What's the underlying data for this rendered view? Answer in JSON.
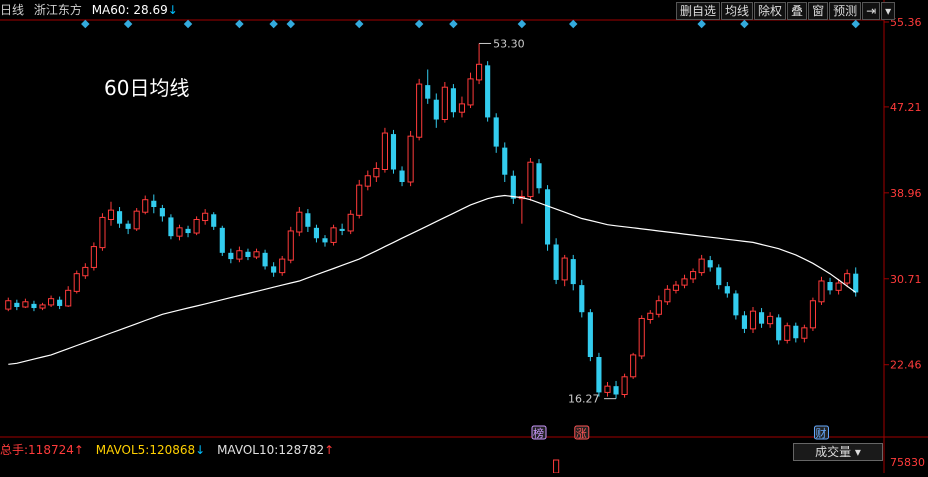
{
  "header": {
    "period": "日线",
    "stock_name": "浙江东方",
    "ma_label": "MA60:",
    "ma_value": "28.69",
    "ma_arrow": "↓"
  },
  "toolbar": {
    "buttons": [
      "删自选",
      "均线",
      "除权",
      "叠",
      "窗",
      "预测"
    ],
    "nav_icon": "nav-arrow-icon",
    "dropdown_icon": "triangle-down-icon"
  },
  "annotation": "60日均线",
  "volume_bar": {
    "total_label": "总手:",
    "total_value": "118724",
    "total_arrow": "↑",
    "mavol5_label": "MAVOL5:",
    "mavol5_value": "120868",
    "mavol5_arrow": "↓",
    "mavol10_label": "MAVOL10:",
    "mavol10_value": "128782",
    "mavol10_arrow": "↑",
    "indicator_button": "成交量"
  },
  "markers": {
    "bang": "榜",
    "zhang": "涨",
    "cai": "财"
  },
  "colors": {
    "background": "#000000",
    "up": "#ff3b3b",
    "down": "#33ccee",
    "ma_line": "#ffffff",
    "axis": "#a00000",
    "info_diamond": "#33aadd"
  },
  "chart_data": {
    "type": "candlestick",
    "y_axis_ticks": [
      "55.36",
      "47.21",
      "38.96",
      "30.71",
      "22.46"
    ],
    "ylim": [
      16.0,
      55.36
    ],
    "volume_axis_label": "75830",
    "high_label": "53.30",
    "low_label": "16.27",
    "series": [
      {
        "name": "MA60",
        "values": [
          22.5,
          22.6,
          22.8,
          23.0,
          23.2,
          23.4,
          23.7,
          24.0,
          24.3,
          24.6,
          24.9,
          25.2,
          25.5,
          25.8,
          26.1,
          26.4,
          26.7,
          27.0,
          27.3,
          27.5,
          27.7,
          27.9,
          28.1,
          28.3,
          28.5,
          28.7,
          28.9,
          29.1,
          29.3,
          29.5,
          29.7,
          29.9,
          30.1,
          30.3,
          30.5,
          30.8,
          31.1,
          31.4,
          31.7,
          32.0,
          32.3,
          32.6,
          33.0,
          33.4,
          33.8,
          34.2,
          34.6,
          35.0,
          35.4,
          35.8,
          36.2,
          36.6,
          37.0,
          37.4,
          37.8,
          38.1,
          38.4,
          38.6,
          38.7,
          38.6,
          38.5,
          38.3,
          38.0,
          37.7,
          37.4,
          37.1,
          36.8,
          36.5,
          36.3,
          36.1,
          35.9,
          35.8,
          35.7,
          35.6,
          35.5,
          35.4,
          35.3,
          35.2,
          35.1,
          35.0,
          34.9,
          34.8,
          34.7,
          34.6,
          34.5,
          34.4,
          34.3,
          34.2,
          34.0,
          33.8,
          33.6,
          33.3,
          33.0,
          32.6,
          32.2,
          31.7,
          31.2,
          30.6,
          30.0,
          29.4
        ]
      }
    ],
    "candles": [
      [
        27.8,
        28.6,
        27.6,
        28.9
      ],
      [
        28.4,
        28.0,
        27.7,
        28.7
      ],
      [
        28.0,
        28.5,
        27.9,
        28.8
      ],
      [
        28.3,
        27.9,
        27.6,
        28.6
      ],
      [
        27.9,
        28.2,
        27.7,
        28.4
      ],
      [
        28.2,
        28.8,
        28.0,
        29.1
      ],
      [
        28.7,
        28.1,
        27.8,
        29.0
      ],
      [
        28.1,
        29.6,
        28.0,
        30.0
      ],
      [
        29.5,
        31.2,
        29.3,
        31.5
      ],
      [
        31.0,
        31.8,
        30.7,
        32.2
      ],
      [
        31.8,
        33.8,
        31.5,
        34.2
      ],
      [
        33.7,
        36.6,
        33.4,
        37.0
      ],
      [
        36.4,
        37.3,
        35.8,
        38.1
      ],
      [
        37.2,
        36.0,
        35.6,
        37.6
      ],
      [
        36.0,
        35.5,
        35.0,
        36.3
      ],
      [
        35.5,
        37.2,
        35.3,
        37.5
      ],
      [
        37.1,
        38.3,
        36.9,
        38.7
      ],
      [
        38.2,
        37.6,
        37.0,
        38.8
      ],
      [
        37.5,
        36.7,
        36.2,
        37.8
      ],
      [
        36.6,
        34.8,
        34.5,
        36.9
      ],
      [
        34.8,
        35.6,
        34.4,
        35.9
      ],
      [
        35.5,
        35.1,
        34.7,
        35.8
      ],
      [
        35.1,
        36.4,
        34.9,
        36.7
      ],
      [
        36.3,
        37.0,
        35.9,
        37.4
      ],
      [
        36.9,
        35.7,
        35.4,
        37.1
      ],
      [
        35.6,
        33.2,
        32.9,
        35.8
      ],
      [
        33.2,
        32.6,
        32.2,
        33.6
      ],
      [
        32.6,
        33.4,
        32.3,
        33.8
      ],
      [
        33.3,
        32.8,
        32.5,
        33.6
      ],
      [
        32.8,
        33.3,
        32.6,
        33.6
      ],
      [
        33.2,
        31.9,
        31.6,
        33.5
      ],
      [
        31.9,
        31.3,
        30.9,
        32.3
      ],
      [
        31.3,
        32.6,
        31.0,
        32.9
      ],
      [
        32.5,
        35.3,
        32.2,
        35.7
      ],
      [
        35.2,
        37.1,
        34.8,
        37.6
      ],
      [
        37.0,
        35.7,
        35.2,
        37.4
      ],
      [
        35.6,
        34.6,
        34.2,
        35.9
      ],
      [
        34.6,
        34.2,
        33.8,
        34.9
      ],
      [
        34.2,
        35.6,
        33.9,
        35.9
      ],
      [
        35.5,
        35.3,
        34.9,
        36.0
      ],
      [
        35.3,
        36.9,
        35.0,
        37.3
      ],
      [
        36.8,
        39.7,
        36.5,
        40.2
      ],
      [
        39.6,
        40.6,
        39.2,
        41.1
      ],
      [
        40.5,
        41.3,
        40.0,
        41.9
      ],
      [
        41.2,
        44.7,
        40.9,
        45.2
      ],
      [
        44.6,
        41.2,
        40.8,
        45.0
      ],
      [
        41.1,
        40.0,
        39.6,
        41.5
      ],
      [
        40.0,
        44.4,
        39.6,
        44.9
      ],
      [
        44.3,
        49.4,
        44.0,
        49.9
      ],
      [
        49.3,
        48.0,
        47.5,
        50.8
      ],
      [
        47.9,
        46.0,
        45.2,
        48.5
      ],
      [
        46.0,
        49.1,
        45.7,
        49.6
      ],
      [
        49.0,
        46.7,
        46.2,
        49.4
      ],
      [
        46.7,
        47.5,
        46.2,
        48.2
      ],
      [
        47.4,
        49.9,
        47.1,
        50.5
      ],
      [
        49.8,
        51.3,
        49.4,
        53.3
      ],
      [
        51.2,
        46.2,
        45.8,
        51.6
      ],
      [
        46.2,
        43.4,
        42.8,
        46.6
      ],
      [
        43.3,
        40.7,
        40.0,
        43.8
      ],
      [
        40.6,
        38.4,
        37.9,
        41.1
      ],
      [
        38.4,
        38.6,
        36.0,
        39.2
      ],
      [
        38.6,
        41.9,
        38.2,
        42.3
      ],
      [
        41.8,
        39.4,
        38.9,
        42.2
      ],
      [
        39.3,
        34.0,
        33.4,
        39.7
      ],
      [
        34.0,
        30.6,
        30.2,
        34.6
      ],
      [
        30.6,
        32.7,
        30.0,
        33.0
      ],
      [
        32.6,
        30.2,
        29.6,
        33.0
      ],
      [
        30.1,
        27.5,
        27.0,
        30.6
      ],
      [
        27.5,
        23.2,
        22.8,
        27.8
      ],
      [
        23.2,
        19.8,
        19.4,
        23.6
      ],
      [
        19.8,
        20.4,
        19.4,
        20.8
      ],
      [
        20.4,
        19.6,
        19.2,
        20.9
      ],
      [
        19.6,
        21.3,
        19.3,
        21.6
      ],
      [
        21.3,
        23.4,
        21.1,
        23.6
      ],
      [
        23.3,
        26.9,
        23.0,
        27.2
      ],
      [
        26.8,
        27.4,
        26.4,
        27.7
      ],
      [
        27.3,
        28.6,
        27.0,
        29.1
      ],
      [
        28.5,
        29.7,
        28.2,
        30.1
      ],
      [
        29.6,
        30.1,
        29.3,
        30.5
      ],
      [
        30.1,
        30.7,
        29.8,
        31.1
      ],
      [
        30.7,
        31.4,
        30.3,
        31.7
      ],
      [
        31.3,
        32.6,
        31.0,
        33.0
      ],
      [
        32.5,
        31.8,
        31.4,
        32.9
      ],
      [
        31.8,
        30.1,
        29.7,
        32.1
      ],
      [
        30.0,
        29.3,
        28.9,
        30.4
      ],
      [
        29.3,
        27.2,
        26.8,
        29.6
      ],
      [
        27.2,
        25.9,
        25.5,
        27.6
      ],
      [
        25.9,
        27.6,
        25.5,
        28.0
      ],
      [
        27.5,
        26.4,
        26.0,
        27.9
      ],
      [
        26.4,
        27.1,
        26.0,
        27.5
      ],
      [
        27.0,
        24.8,
        24.4,
        27.3
      ],
      [
        24.8,
        26.2,
        24.5,
        26.5
      ],
      [
        26.2,
        25.0,
        24.6,
        26.5
      ],
      [
        25.0,
        26.0,
        24.6,
        26.3
      ],
      [
        26.0,
        28.6,
        25.7,
        28.9
      ],
      [
        28.5,
        30.5,
        28.2,
        30.9
      ],
      [
        30.4,
        29.6,
        29.2,
        30.8
      ],
      [
        29.6,
        30.3,
        29.2,
        30.7
      ],
      [
        30.3,
        31.2,
        29.9,
        31.6
      ],
      [
        31.2,
        29.4,
        29.0,
        31.8
      ]
    ],
    "x_labels": []
  }
}
